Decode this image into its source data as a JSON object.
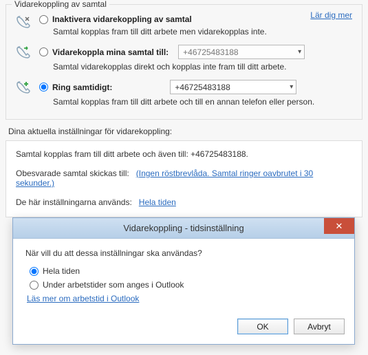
{
  "forwarding": {
    "legend": "Vidarekoppling av samtal",
    "learn_more": "Lär dig mer",
    "options": [
      {
        "label": "Inaktivera vidarekoppling av samtal",
        "desc": "Samtal kopplas fram till ditt arbete men vidarekopplas inte.",
        "checked": false,
        "dropdown": null
      },
      {
        "label": "Vidarekoppla mina samtal till:",
        "desc": "Samtal vidarekopplas direkt och kopplas inte fram till ditt arbete.",
        "checked": false,
        "dropdown": "+46725483188"
      },
      {
        "label": "Ring samtidigt:",
        "desc": "Samtal kopplas fram till ditt arbete och till en annan telefon eller person.",
        "checked": true,
        "dropdown": "+46725483188"
      }
    ]
  },
  "current": {
    "header": "Dina aktuella inställningar för vidarekoppling:",
    "line1": "Samtal kopplas fram till ditt arbete  och även till: +46725483188.",
    "unanswered_label": "Obesvarade samtal skickas till:",
    "unanswered_link": "(Ingen röstbrevlåda. Samtal ringer oavbrutet i 30 sekunder.)",
    "applies_label": "De här inställningarna används:",
    "applies_link": "Hela tiden"
  },
  "dialog": {
    "title": "Vidarekoppling - tidsinställning",
    "question": "När vill du att dessa inställningar ska användas?",
    "opts": [
      {
        "label": "Hela tiden",
        "checked": true
      },
      {
        "label": "Under arbetstider som anges i Outlook",
        "checked": false
      }
    ],
    "learn_link": "Läs mer om arbetstid i Outlook",
    "ok": "OK",
    "cancel": "Avbryt"
  }
}
